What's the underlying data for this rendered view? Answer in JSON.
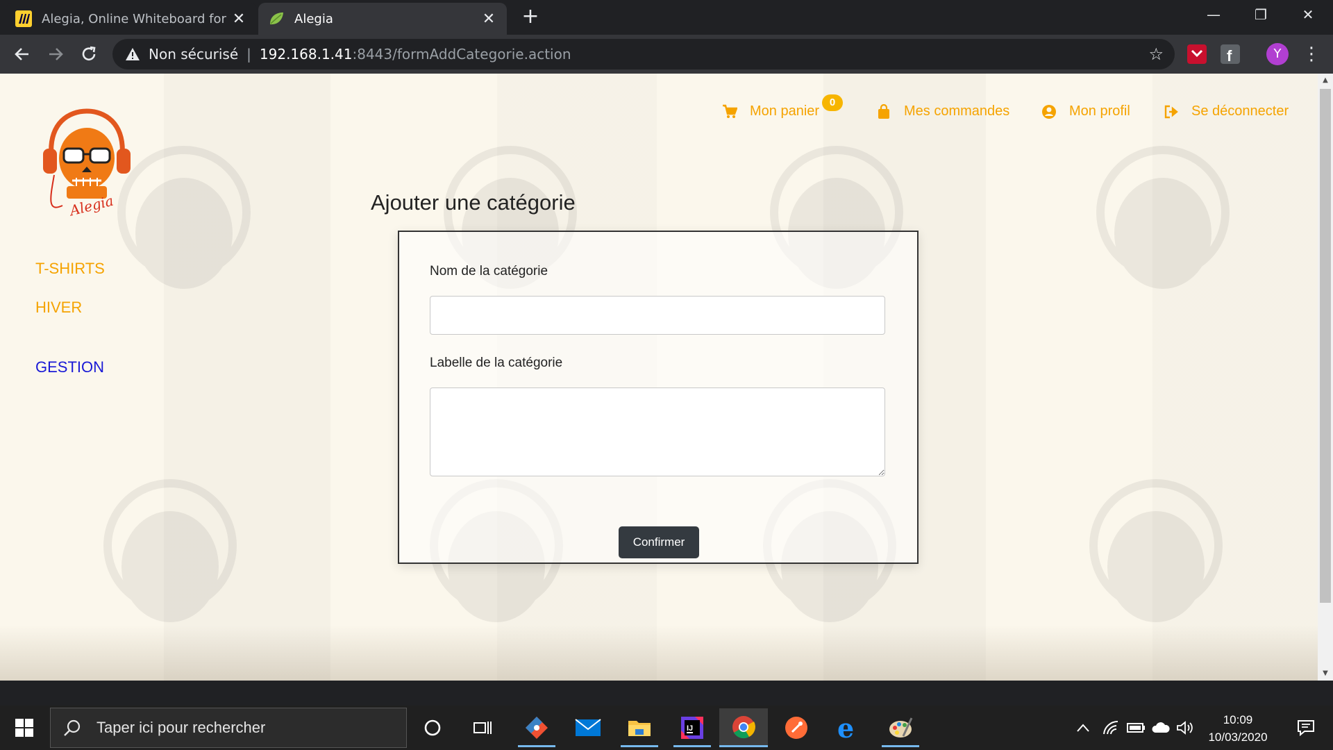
{
  "browser": {
    "tabs": [
      {
        "title": "Alegia, Online Whiteboard for Vi",
        "active": false
      },
      {
        "title": "Alegia",
        "active": true
      }
    ],
    "address": {
      "security_label": "Non sécurisé",
      "host": "192.168.1.41",
      "path": ":8443/formAddCategorie.action"
    },
    "profile_initial": "Y"
  },
  "site": {
    "top_nav": {
      "cart_label": "Mon panier",
      "cart_count": "0",
      "orders_label": "Mes commandes",
      "profile_label": "Mon profil",
      "logout_label": "Se déconnecter"
    },
    "side_nav": {
      "categories": [
        "T-SHIRTS",
        "HIVER"
      ],
      "admin_label": "GESTION"
    },
    "page_title": "Ajouter une catégorie",
    "form": {
      "name_label": "Nom de la catégorie",
      "name_value": "",
      "label_label": "Labelle de la catégorie",
      "label_value": "",
      "submit_label": "Confirmer"
    },
    "colors": {
      "accent": "#f5a300",
      "admin_link": "#1a1ad6",
      "button": "#343a40"
    }
  },
  "taskbar": {
    "search_placeholder": "Taper ici pour rechercher",
    "time": "10:09",
    "date": "10/03/2020"
  }
}
